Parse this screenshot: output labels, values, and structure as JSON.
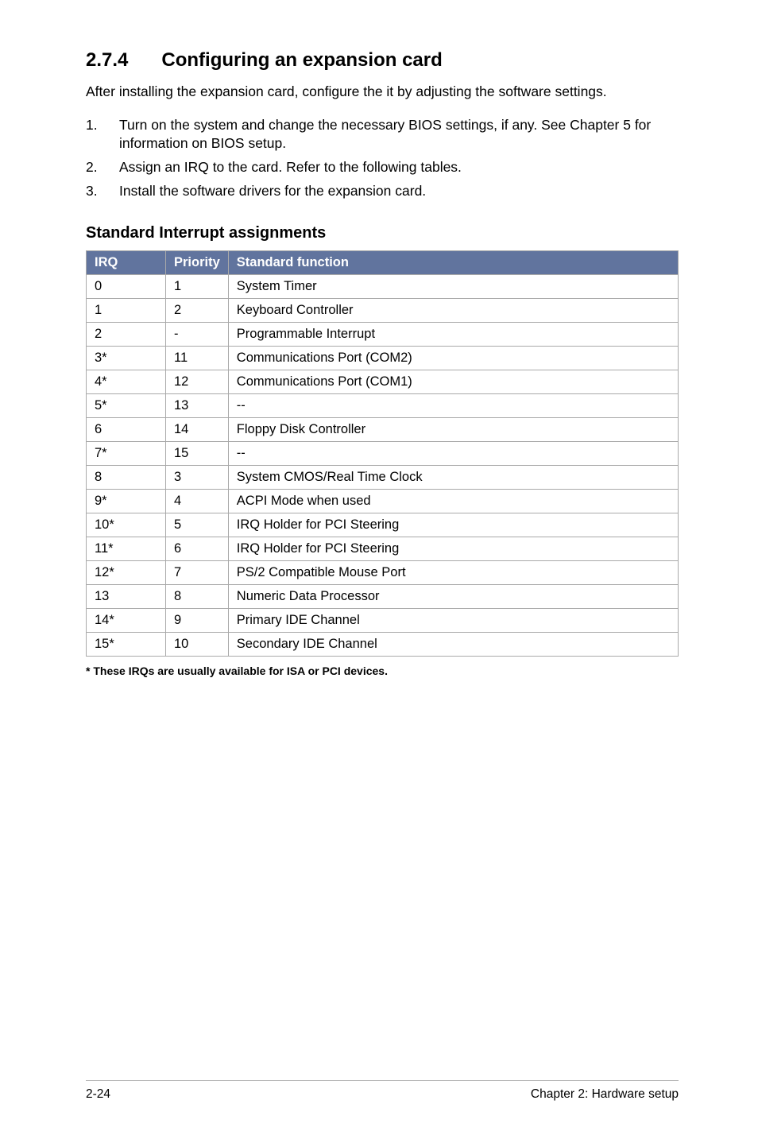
{
  "heading": {
    "number": "2.7.4",
    "title": "Configuring an expansion card"
  },
  "intro": "After installing the expansion card, configure the it by adjusting the software settings.",
  "steps": [
    {
      "num": "1.",
      "text": "Turn on the system and change the necessary BIOS settings, if any. See Chapter 5 for information on BIOS setup."
    },
    {
      "num": "2.",
      "text": "Assign an IRQ to the card. Refer to the following tables."
    },
    {
      "num": "3.",
      "text": "Install the software drivers for the expansion card."
    }
  ],
  "subheading": "Standard Interrupt assignments",
  "table": {
    "headers": {
      "irq": "IRQ",
      "priority": "Priority",
      "func": "Standard function"
    },
    "rows": [
      {
        "irq": "0",
        "priority": "1",
        "func": "System Timer"
      },
      {
        "irq": "1",
        "priority": "2",
        "func": "Keyboard Controller"
      },
      {
        "irq": "2",
        "priority": "-",
        "func": "Programmable Interrupt"
      },
      {
        "irq": "3*",
        "priority": "11",
        "func": "Communications Port (COM2)"
      },
      {
        "irq": "4*",
        "priority": "12",
        "func": "Communications Port (COM1)"
      },
      {
        "irq": "5*",
        "priority": "13",
        "func": "--"
      },
      {
        "irq": "6",
        "priority": "14",
        "func": "Floppy Disk Controller"
      },
      {
        "irq": "7*",
        "priority": "15",
        "func": "--"
      },
      {
        "irq": "8",
        "priority": "3",
        "func": "System CMOS/Real Time Clock"
      },
      {
        "irq": "9*",
        "priority": "4",
        "func": "ACPI Mode when used"
      },
      {
        "irq": "10*",
        "priority": "5",
        "func": "IRQ Holder for PCI Steering"
      },
      {
        "irq": "11*",
        "priority": "6",
        "func": "IRQ Holder for PCI Steering"
      },
      {
        "irq": "12*",
        "priority": "7",
        "func": "PS/2 Compatible Mouse Port"
      },
      {
        "irq": "13",
        "priority": "8",
        "func": "Numeric Data Processor"
      },
      {
        "irq": "14*",
        "priority": "9",
        "func": "Primary IDE Channel"
      },
      {
        "irq": "15*",
        "priority": "10",
        "func": "Secondary IDE Channel"
      }
    ]
  },
  "footnote": "* These IRQs are usually available for ISA or PCI devices.",
  "footer": {
    "left": "2-24",
    "right": "Chapter 2:  Hardware setup"
  }
}
